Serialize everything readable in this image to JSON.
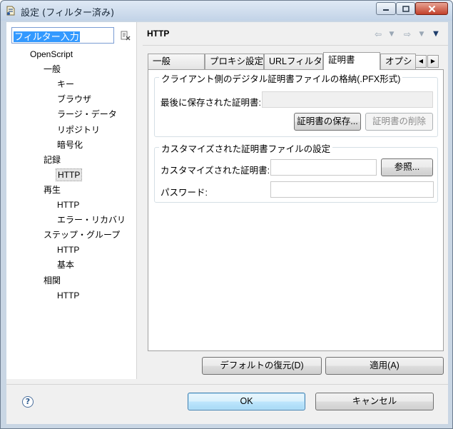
{
  "window": {
    "title": "設定 (フィルター済み)"
  },
  "filter": {
    "value": "フィルター入力"
  },
  "tree": [
    {
      "label": "OpenScript",
      "level": 0
    },
    {
      "label": "一般",
      "level": 1
    },
    {
      "label": "キー",
      "level": 2
    },
    {
      "label": "ブラウザ",
      "level": 2
    },
    {
      "label": "ラージ・データ",
      "level": 2
    },
    {
      "label": "リポジトリ",
      "level": 2
    },
    {
      "label": "暗号化",
      "level": 2
    },
    {
      "label": "記録",
      "level": 1
    },
    {
      "label": "HTTP",
      "level": 2,
      "selected": true
    },
    {
      "label": "再生",
      "level": 1
    },
    {
      "label": "HTTP",
      "level": 2
    },
    {
      "label": "エラー・リカバリ",
      "level": 2
    },
    {
      "label": "ステップ・グループ",
      "level": 1
    },
    {
      "label": "HTTP",
      "level": 2
    },
    {
      "label": "基本",
      "level": 2
    },
    {
      "label": "相関",
      "level": 1
    },
    {
      "label": "HTTP",
      "level": 2
    }
  ],
  "page": {
    "title": "HTTP"
  },
  "tabs": [
    {
      "label": "一般"
    },
    {
      "label": "プロキシ設定"
    },
    {
      "label": "URLフィルタ"
    },
    {
      "label": "証明書",
      "active": true
    },
    {
      "label": "オプシ"
    }
  ],
  "client_cert": {
    "legend": "クライアント側のデジタル証明書ファイルの格納(.PFX形式)",
    "last_saved_label": "最後に保存された証明書:",
    "last_saved_value": "",
    "save_button": "証明書の保存...",
    "delete_button": "証明書の削除"
  },
  "custom_cert": {
    "legend": "カスタマイズされた証明書ファイルの設定",
    "cert_label": "カスタマイズされた証明書:",
    "cert_value": "",
    "browse_button": "参照...",
    "password_label": "パスワード:",
    "password_value": ""
  },
  "actions": {
    "restore_defaults": "デフォルトの復元(D)",
    "apply": "適用(A)",
    "ok": "OK",
    "cancel": "キャンセル"
  },
  "icons": {
    "help": "?"
  },
  "colors": {
    "selection": "#3399ff",
    "close_button": "#c2412c"
  }
}
